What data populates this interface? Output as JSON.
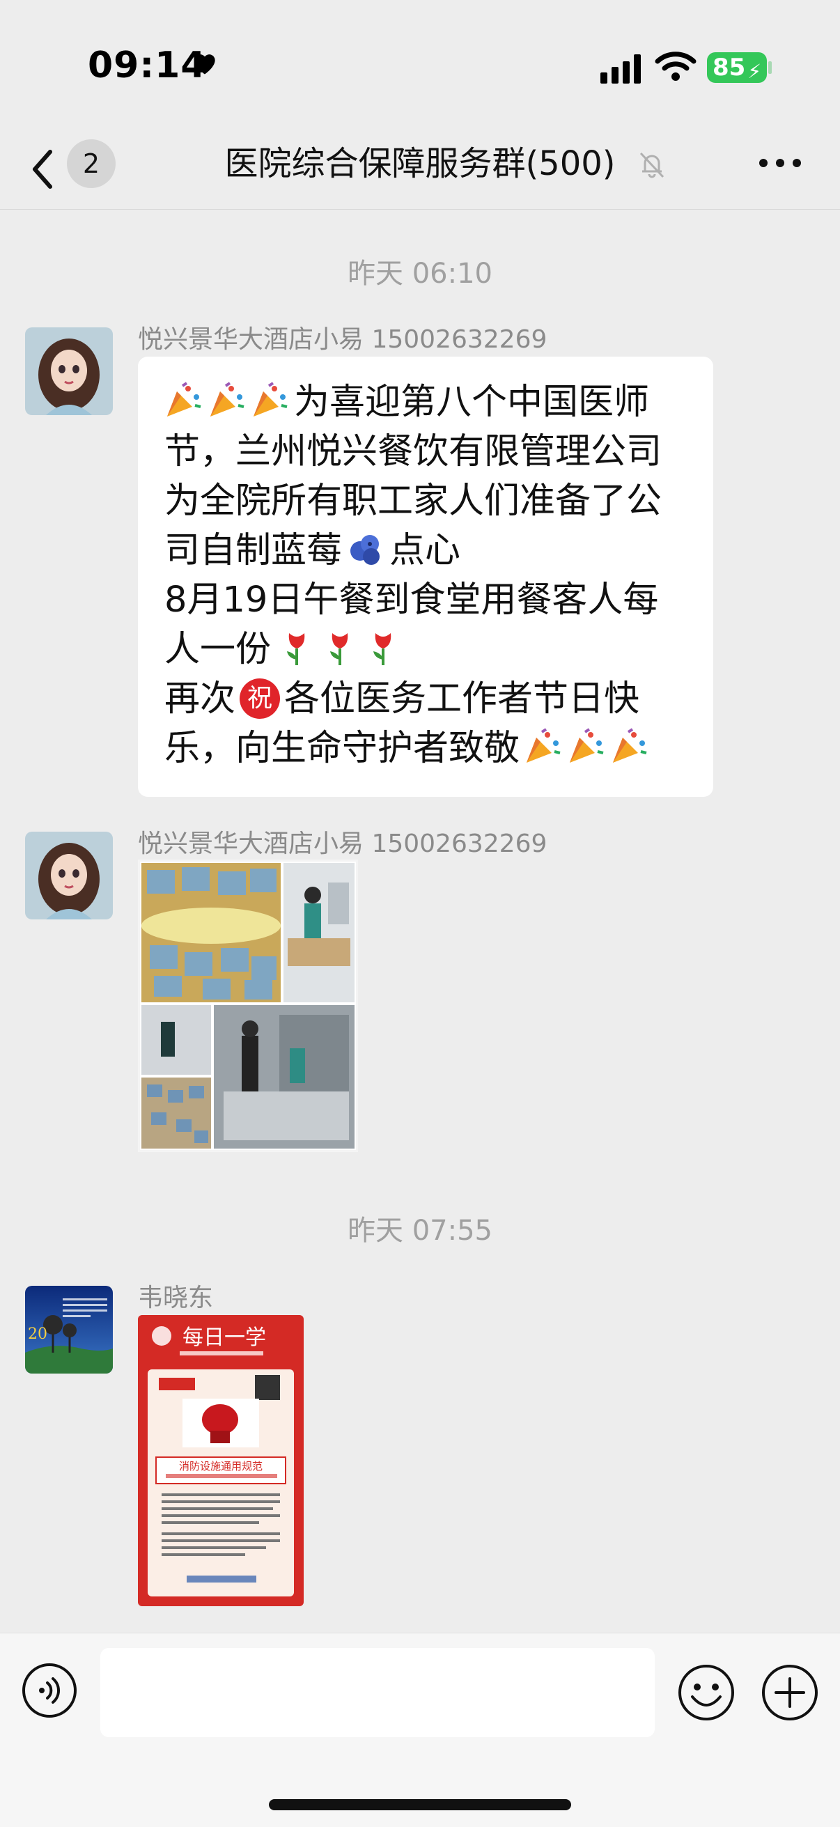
{
  "status_bar": {
    "time": "09:14",
    "battery": "85"
  },
  "nav": {
    "unread_count": "2",
    "title": "医院综合保障服务群(500)"
  },
  "messages": [
    {
      "timestamp": "昨天 06:10",
      "sender": "悦兴景华大酒店小易 15002632269",
      "lines": [
        "为喜迎第八个中国医师",
        "节，兰州悦兴餐饮有限管理公司",
        "为全院所有职工家人们准备了公",
        "司自制蓝莓",
        "点心",
        "8月19日午餐到食堂用餐客人每",
        "人一份",
        "再次",
        "祝",
        "各位医务工作者节日快",
        "乐，向生命守护者致敬"
      ]
    },
    {
      "sender": "悦兴景华大酒店小易 15002632269",
      "image": "photo-collage"
    },
    {
      "timestamp": "昨天 07:55",
      "sender": "韦晓东",
      "image": "fire-safety-poster"
    }
  ],
  "poster": {
    "title": "每日一学",
    "heading": "消防设施通用规范"
  },
  "icons": {
    "party": "party-popper-icon",
    "blueberry": "blueberry-icon",
    "tulip": "tulip-icon"
  },
  "colors": {
    "background": "#ededed",
    "bubble": "#ffffff",
    "battery": "#34c759",
    "poster_red": "#d42a25"
  }
}
